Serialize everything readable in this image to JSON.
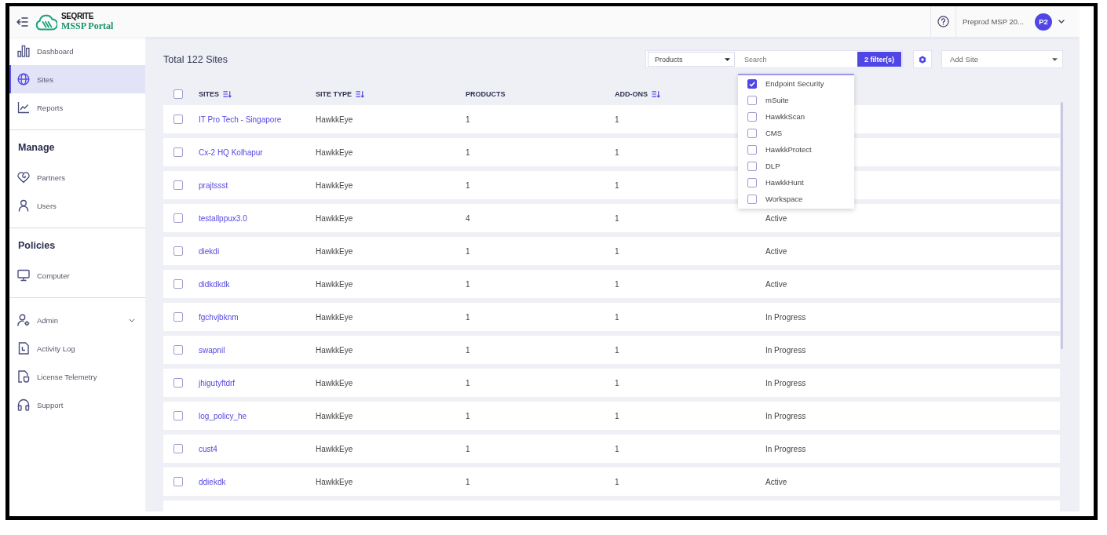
{
  "header": {
    "logo_brand": "SEQRITE",
    "logo_product": "MSSP Portal",
    "account_name": "Preprod MSP 20...",
    "avatar_initials": "P2"
  },
  "sidebar": {
    "sections": [
      {
        "items": [
          {
            "label": "Dashboard",
            "selected": false
          },
          {
            "label": "Sites",
            "selected": true
          },
          {
            "label": "Reports",
            "selected": false
          }
        ]
      },
      {
        "heading": "Manage",
        "items": [
          {
            "label": "Partners",
            "selected": false
          },
          {
            "label": "Users",
            "selected": false
          }
        ]
      },
      {
        "heading": "Policies",
        "items": [
          {
            "label": "Computer",
            "selected": false
          }
        ]
      },
      {
        "items": [
          {
            "label": "Admin",
            "selected": false,
            "expanded": false
          },
          {
            "label": "Activity Log",
            "selected": false
          },
          {
            "label": "License Telemetry",
            "selected": false
          },
          {
            "label": "Support",
            "selected": false
          }
        ]
      }
    ]
  },
  "toolbar": {
    "title": "Total 122 Sites",
    "product_select": {
      "value": "Products"
    },
    "search": {
      "placeholder": "Search"
    },
    "filter_button": "2 filter(s)",
    "add_site_select": {
      "value": "Add Site"
    }
  },
  "product_dropdown": {
    "options": [
      {
        "label": "Endpoint Security",
        "checked": true
      },
      {
        "label": "mSuite",
        "checked": false
      },
      {
        "label": "HawkkScan",
        "checked": false
      },
      {
        "label": "CMS",
        "checked": false
      },
      {
        "label": "HawkkProtect",
        "checked": false
      },
      {
        "label": "DLP",
        "checked": false
      },
      {
        "label": "HawkkHunt",
        "checked": false
      },
      {
        "label": "Workspace",
        "checked": false
      }
    ]
  },
  "table": {
    "select_all_checked": false,
    "columns": [
      {
        "label": "SITES",
        "sortable": true
      },
      {
        "label": "SITE TYPE",
        "sortable": true
      },
      {
        "label": "PRODUCTS",
        "sortable": false
      },
      {
        "label": "ADD-ONS",
        "sortable": true
      }
    ],
    "rows": [
      {
        "site": "IT Pro Tech - Singapore",
        "site_type": "HawkkEye",
        "products": "1",
        "add_ons": "1",
        "checked": false
      },
      {
        "site": "Cx-2 HQ Kolhapur",
        "site_type": "HawkkEye",
        "products": "1",
        "add_ons": "1",
        "checked": false
      },
      {
        "site": "prajtssst",
        "site_type": "HawkkEye",
        "products": "1",
        "add_ons": "1",
        "checked": false
      },
      {
        "site": "testallppux3.0",
        "site_type": "HawkkEye",
        "products": "4",
        "add_ons": "1",
        "status": "Active",
        "checked": false
      },
      {
        "site": "diekdi",
        "site_type": "HawkkEye",
        "products": "1",
        "add_ons": "1",
        "status": "Active",
        "checked": false
      },
      {
        "site": "didkdkdk",
        "site_type": "HawkkEye",
        "products": "1",
        "add_ons": "1",
        "status": "Active",
        "checked": false
      },
      {
        "site": "fgchvjbknm",
        "site_type": "HawkkEye",
        "products": "1",
        "add_ons": "1",
        "status": "In Progress",
        "checked": false
      },
      {
        "site": "swapnil",
        "site_type": "HawkkEye",
        "products": "1",
        "add_ons": "1",
        "status": "In Progress",
        "checked": false
      },
      {
        "site": "jhigutyftdrf",
        "site_type": "HawkkEye",
        "products": "1",
        "add_ons": "1",
        "status": "In Progress",
        "checked": false
      },
      {
        "site": "log_policy_he",
        "site_type": "HawkkEye",
        "products": "1",
        "add_ons": "1",
        "status": "In Progress",
        "checked": false
      },
      {
        "site": "cust4",
        "site_type": "HawkkEye",
        "products": "1",
        "add_ons": "1",
        "status": "In Progress",
        "checked": false
      },
      {
        "site": "ddiekdk",
        "site_type": "HawkkEye",
        "products": "1",
        "add_ons": "1",
        "status": "Active",
        "checked": false
      }
    ]
  }
}
